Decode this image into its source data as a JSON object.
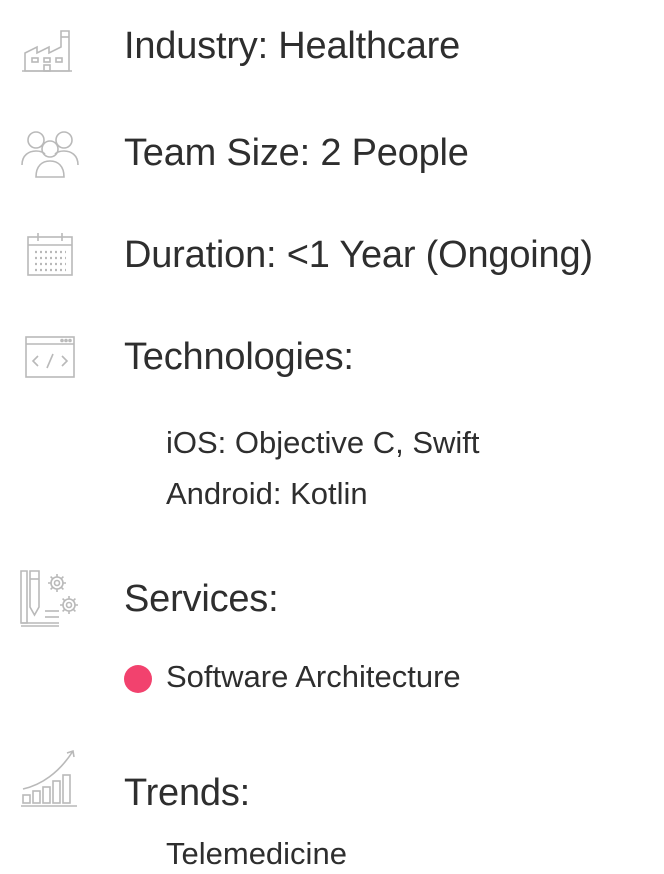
{
  "colors": {
    "accent": "#f2426e",
    "icon_stroke": "#b9b9b9",
    "text": "#2e2e2e"
  },
  "industry": {
    "icon": "factory-icon",
    "label": "Industry: Healthcare"
  },
  "team": {
    "icon": "people-group-icon",
    "label": "Team Size: 2 People"
  },
  "duration": {
    "icon": "calendar-icon",
    "label": "Duration: <1 Year (Ongoing)"
  },
  "technologies": {
    "icon": "code-window-icon",
    "label": "Technologies:",
    "items": [
      "iOS: Objective C, Swift",
      "Android: Kotlin"
    ]
  },
  "services": {
    "icon": "design-gears-icon",
    "label": "Services:",
    "items": [
      "Software Architecture"
    ]
  },
  "trends": {
    "icon": "growth-chart-icon",
    "label": "Trends:",
    "items": [
      "Telemedicine"
    ]
  }
}
